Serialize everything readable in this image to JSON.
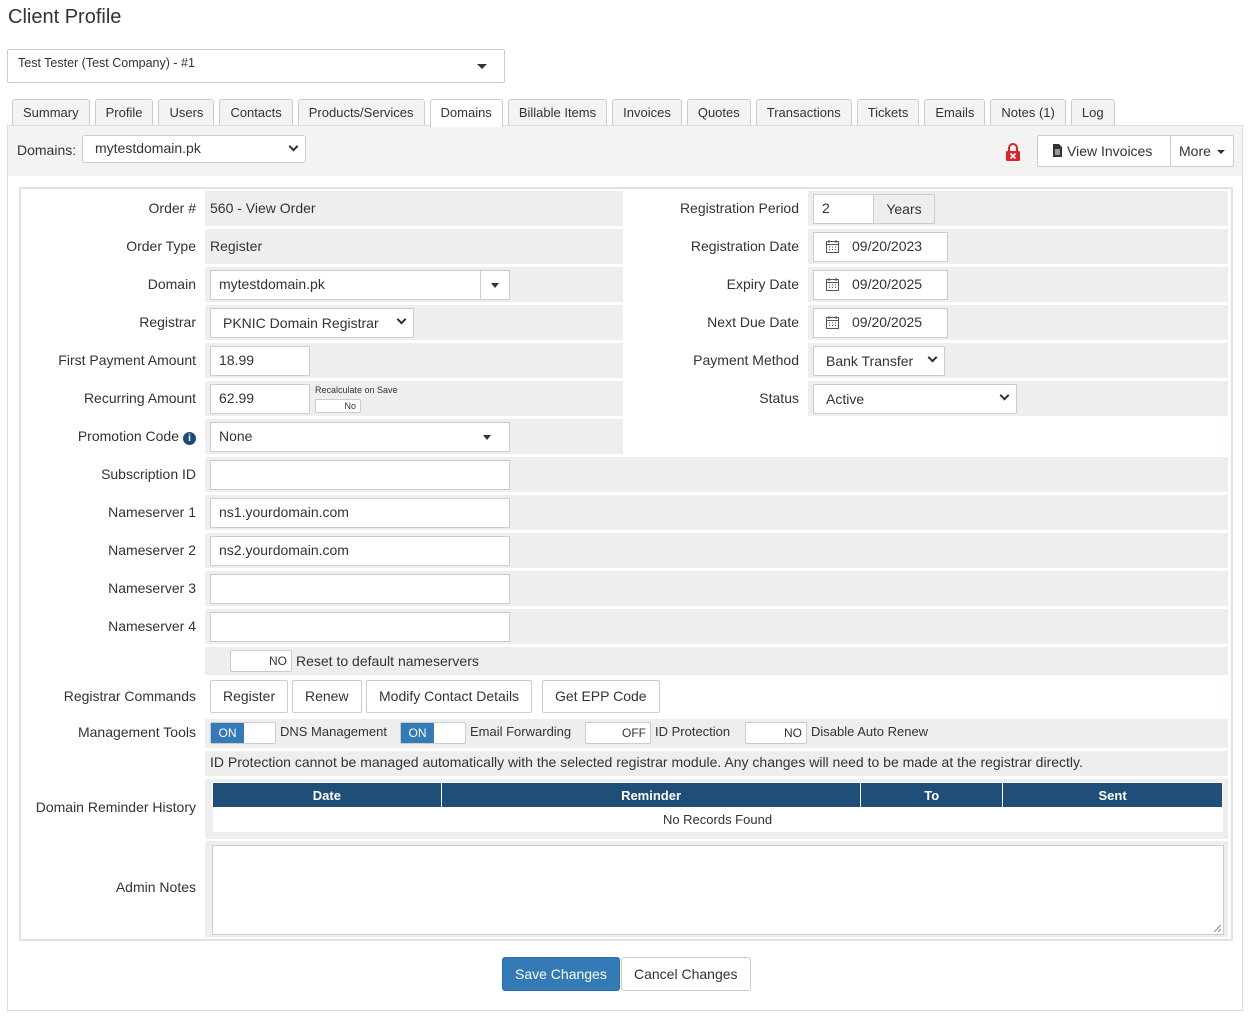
{
  "page": {
    "title": "Client Profile"
  },
  "client_selector": {
    "value": "Test Tester (Test Company) - #1"
  },
  "tabs": [
    {
      "label": "Summary"
    },
    {
      "label": "Profile"
    },
    {
      "label": "Users"
    },
    {
      "label": "Contacts"
    },
    {
      "label": "Products/Services"
    },
    {
      "label": "Domains"
    },
    {
      "label": "Billable Items"
    },
    {
      "label": "Invoices"
    },
    {
      "label": "Quotes"
    },
    {
      "label": "Transactions"
    },
    {
      "label": "Tickets"
    },
    {
      "label": "Emails"
    },
    {
      "label": "Notes (1)"
    },
    {
      "label": "Log"
    }
  ],
  "active_tab": "Domains",
  "toolbar": {
    "domains_label": "Domains:",
    "domain_select": "mytestdomain.pk",
    "view_invoices": "View Invoices",
    "more": "More"
  },
  "form": {
    "order_label": "Order #",
    "order_value": "560 - View Order",
    "order_type_label": "Order Type",
    "order_type_value": "Register",
    "domain_label": "Domain",
    "domain_value": "mytestdomain.pk",
    "registrar_label": "Registrar",
    "registrar_value": "PKNIC Domain Registrar",
    "first_payment_label": "First Payment Amount",
    "first_payment_value": "18.99",
    "recurring_label": "Recurring Amount",
    "recurring_value": "62.99",
    "recalculate_label": "Recalculate on Save",
    "recalculate_toggle": "No",
    "promo_label": "Promotion Code",
    "promo_value": "None",
    "subscription_label": "Subscription ID",
    "subscription_value": "",
    "ns1_label": "Nameserver 1",
    "ns1_value": "ns1.yourdomain.com",
    "ns2_label": "Nameserver 2",
    "ns2_value": "ns2.yourdomain.com",
    "ns3_label": "Nameserver 3",
    "ns3_value": "",
    "ns4_label": "Nameserver 4",
    "ns4_value": "",
    "reset_ns_toggle": "NO",
    "reset_ns_label": "Reset to default nameservers",
    "reg_period_label": "Registration Period",
    "reg_period_value": "2",
    "reg_period_unit": "Years",
    "reg_date_label": "Registration Date",
    "reg_date_value": "09/20/2023",
    "expiry_label": "Expiry Date",
    "expiry_value": "09/20/2025",
    "next_due_label": "Next Due Date",
    "next_due_value": "09/20/2025",
    "payment_method_label": "Payment Method",
    "payment_method_value": "Bank Transfer",
    "status_label": "Status",
    "status_value": "Active",
    "registrar_commands_label": "Registrar Commands",
    "commands": [
      "Register",
      "Renew",
      "Modify Contact Details",
      "Get EPP Code"
    ],
    "management_tools_label": "Management Tools",
    "tools": [
      {
        "state": "ON",
        "label": "DNS Management"
      },
      {
        "state": "ON",
        "label": "Email Forwarding"
      },
      {
        "state": "OFF",
        "label": "ID Protection"
      },
      {
        "state": "NO",
        "label": "Disable Auto Renew"
      }
    ],
    "id_protection_note": "ID Protection cannot be managed automatically with the selected registrar module. Any changes will need to be made at the registrar directly.",
    "reminder_label": "Domain Reminder History",
    "reminder_columns": [
      "Date",
      "Reminder",
      "To",
      "Sent"
    ],
    "reminder_empty": "No Records Found",
    "admin_notes_label": "Admin Notes",
    "admin_notes_value": ""
  },
  "actions": {
    "save": "Save Changes",
    "cancel": "Cancel Changes"
  },
  "colors": {
    "primary": "#337ab7",
    "table_header": "#1f4e79",
    "lock": "#d9232e",
    "row_bg": "#eeeeee"
  }
}
